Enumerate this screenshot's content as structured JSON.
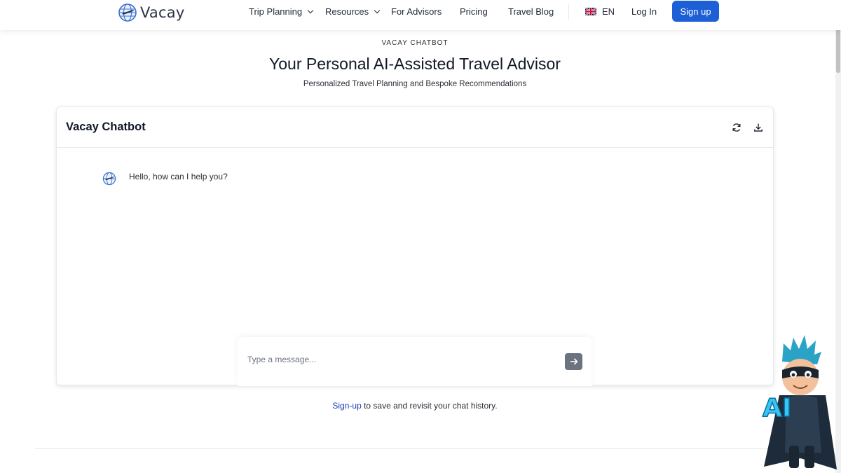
{
  "header": {
    "logo_text": "Vacay",
    "nav": [
      {
        "label": "Trip Planning",
        "dropdown": true
      },
      {
        "label": "Resources",
        "dropdown": true
      },
      {
        "label": "For Advisors",
        "dropdown": false
      },
      {
        "label": "Pricing",
        "dropdown": false
      },
      {
        "label": "Travel Blog",
        "dropdown": false
      }
    ],
    "language": "EN",
    "login_label": "Log In",
    "signup_label": "Sign up"
  },
  "hero": {
    "eyebrow": "VACAY CHATBOT",
    "title": "Your Personal AI-Assisted Travel Advisor",
    "subtitle": "Personalized Travel Planning and Bespoke Recommendations"
  },
  "chat": {
    "title": "Vacay Chatbot",
    "messages": [
      {
        "sender": "bot",
        "text": "Hello, how can I help you?"
      }
    ],
    "input_placeholder": "Type a message...",
    "input_value": ""
  },
  "footnote": {
    "link_text": "Sign-up",
    "rest": " to save and revisit your chat history."
  },
  "mascot": {
    "badge_text": "AI"
  },
  "colors": {
    "primary": "#1d5fd6",
    "link": "#1d3fb3",
    "send_button": "#6b7280"
  },
  "icons": {
    "refresh": "refresh-icon",
    "download": "download-icon",
    "send": "arrow-right-icon",
    "flag": "uk-flag-icon",
    "logo": "globe-plane-icon"
  }
}
